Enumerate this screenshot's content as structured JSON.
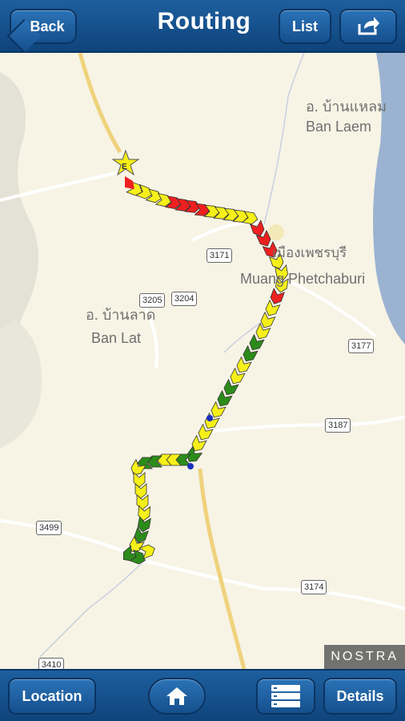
{
  "header": {
    "title": "Routing",
    "back_label": "Back",
    "list_label": "List"
  },
  "footer": {
    "location_label": "Location",
    "details_label": "Details"
  },
  "map": {
    "labels": {
      "ban_laem_thai": "อ. บ้านแหลม",
      "ban_laem": "Ban Laem",
      "mueang_thai": "เมืองเพชรบุรี",
      "mueang": "Muang Phetchaburi",
      "ban_lat_thai": "อ. บ้านลาด",
      "ban_lat": "Ban Lat"
    },
    "roads": [
      "3171",
      "3205",
      "3204",
      "3177",
      "3187",
      "3499",
      "3174",
      "3410"
    ],
    "watermark": "NOSTRA",
    "start_marker": "E"
  },
  "colors": {
    "accent": "#1d5f9e",
    "yellow": "#f5ef1a",
    "red": "#ef2020",
    "green": "#2c8c1a"
  }
}
